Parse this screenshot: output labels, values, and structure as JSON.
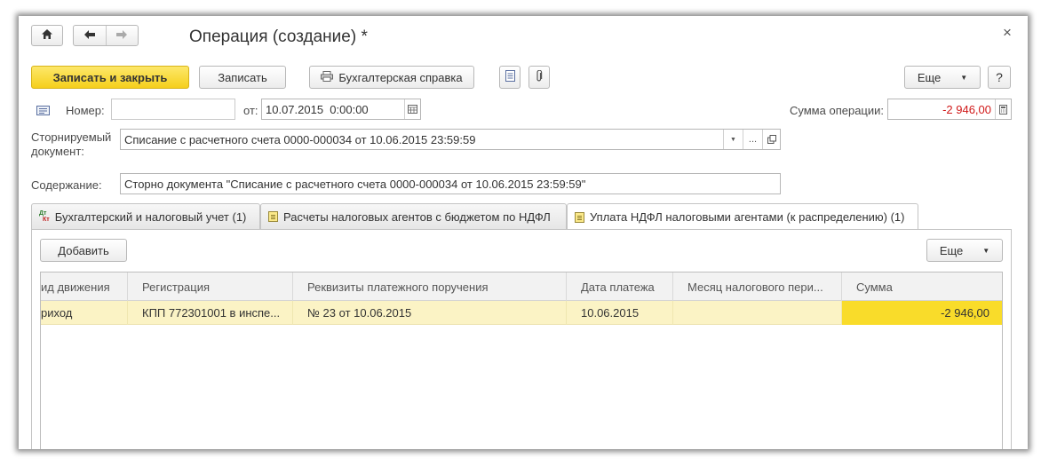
{
  "window": {
    "title": "Операция (создание) *",
    "close_glyph": "×"
  },
  "nav": {
    "home_icon": "home-icon",
    "back_icon": "arrow-left-icon",
    "forward_icon": "arrow-right-icon"
  },
  "toolbar": {
    "save_close_label": "Записать и закрыть",
    "save_label": "Записать",
    "report_label": "Бухгалтерская справка",
    "more_label": "Еще",
    "help_label": "?"
  },
  "form": {
    "number_label": "Номер:",
    "number_value": "",
    "date_label": "от:",
    "date_value": "10.07.2015  0:00:00",
    "sum_label": "Сумма операции:",
    "sum_value": "-2 946,00",
    "storno_label_line1": "Сторнируемый",
    "storno_label_line2": "документ:",
    "storno_value": "Списание с расчетного счета 0000-000034 от 10.06.2015 23:59:59",
    "storno_ellipsis": "...",
    "content_label": "Содержание:",
    "content_value": "Сторно документа \"Списание с расчетного счета 0000-000034 от 10.06.2015 23:59:59\""
  },
  "tabs": [
    {
      "label": "Бухгалтерский и налоговый учет (1)",
      "icon": "dt-kt-icon",
      "active": false
    },
    {
      "label": "Расчеты налоговых агентов с бюджетом по НДФЛ",
      "icon": "document-icon",
      "active": false
    },
    {
      "label": "Уплата НДФЛ налоговыми агентами (к распределению) (1)",
      "icon": "document-icon",
      "active": true
    }
  ],
  "dt_kt_icon_text": {
    "top": "Дт",
    "bottom": "Кт"
  },
  "table_toolbar": {
    "add_label": "Добавить",
    "more_label": "Еще"
  },
  "table": {
    "columns": [
      "ид движения",
      "Регистрация",
      "Реквизиты платежного поручения",
      "Дата платежа",
      "Месяц налогового пери...",
      "Сумма"
    ],
    "rows": [
      [
        "риход",
        "КПП 772301001 в инспе...",
        "№ 23 от 10.06.2015",
        "10.06.2015",
        "",
        "-2 946,00"
      ]
    ]
  },
  "colors": {
    "accent_yellow": "#f5cf1c",
    "row_highlight": "#fbf3c5",
    "cell_selected": "#f9dc2a",
    "negative_sum": "#d01818"
  }
}
